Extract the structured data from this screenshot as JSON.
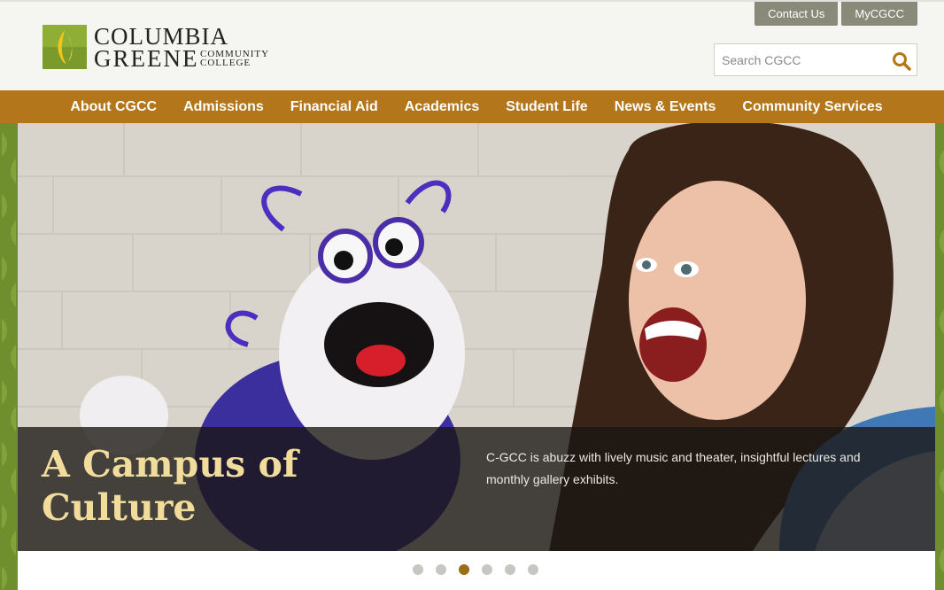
{
  "logo": {
    "line1": "COLUMBIA",
    "line2": "GREENE",
    "sub1": "COMMUNITY",
    "sub2": "COLLEGE",
    "icon": "flame-logo-icon"
  },
  "top_links": [
    "Contact Us",
    "MyCGCC"
  ],
  "search": {
    "placeholder": "Search CGCC",
    "icon": "search-icon"
  },
  "nav": {
    "items": [
      "About CGCC",
      "Admissions",
      "Financial Aid",
      "Academics",
      "Student Life",
      "News & Events",
      "Community Services"
    ]
  },
  "hero": {
    "title": "A Campus of Culture",
    "text": "C-GCC is abuzz with lively music and theater, insightful lectures and monthly gallery exhibits."
  },
  "slider": {
    "count": 6,
    "active": 3
  },
  "colors": {
    "nav_bg": "#b3761a",
    "green": "#6f8f2f",
    "caption_title": "#f1dc9b",
    "active_dot": "#9a6d17"
  }
}
